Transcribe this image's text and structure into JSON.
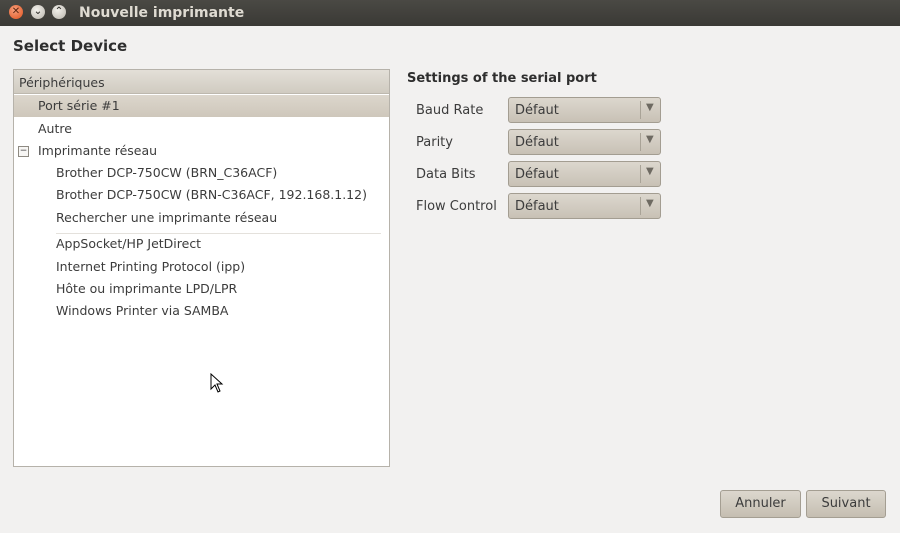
{
  "window": {
    "title": "Nouvelle imprimante",
    "close_glyph": "✕",
    "min_glyph": "⌄",
    "max_glyph": "⌃"
  },
  "heading": "Select Device",
  "device_list": {
    "header": "Périphériques",
    "expander_glyph": "−",
    "items": [
      {
        "label": "Port série #1",
        "selected": true
      },
      {
        "label": "Autre"
      },
      {
        "label": "Imprimante réseau",
        "expanded": true
      },
      {
        "label": "Brother DCP-750CW (BRN_C36ACF)"
      },
      {
        "label": "Brother DCP-750CW (BRN-C36ACF, 192.168.1.12)"
      },
      {
        "label": "Rechercher une imprimante réseau"
      },
      {
        "label": "AppSocket/HP JetDirect"
      },
      {
        "label": "Internet Printing Protocol (ipp)"
      },
      {
        "label": "Hôte ou imprimante LPD/LPR"
      },
      {
        "label": "Windows Printer via SAMBA"
      }
    ]
  },
  "settings": {
    "title": "Settings of the serial port",
    "arrow_glyph": "▼",
    "fields": [
      {
        "label": "Baud Rate",
        "value": "Défaut"
      },
      {
        "label": "Parity",
        "value": "Défaut"
      },
      {
        "label": "Data Bits",
        "value": "Défaut"
      },
      {
        "label": "Flow Control",
        "value": "Défaut"
      }
    ]
  },
  "buttons": {
    "cancel": "Annuler",
    "next": "Suivant"
  },
  "colors": {
    "titlebar": "#3c3b37",
    "selection": "#d6d0c6",
    "close_button": "#e95420"
  }
}
